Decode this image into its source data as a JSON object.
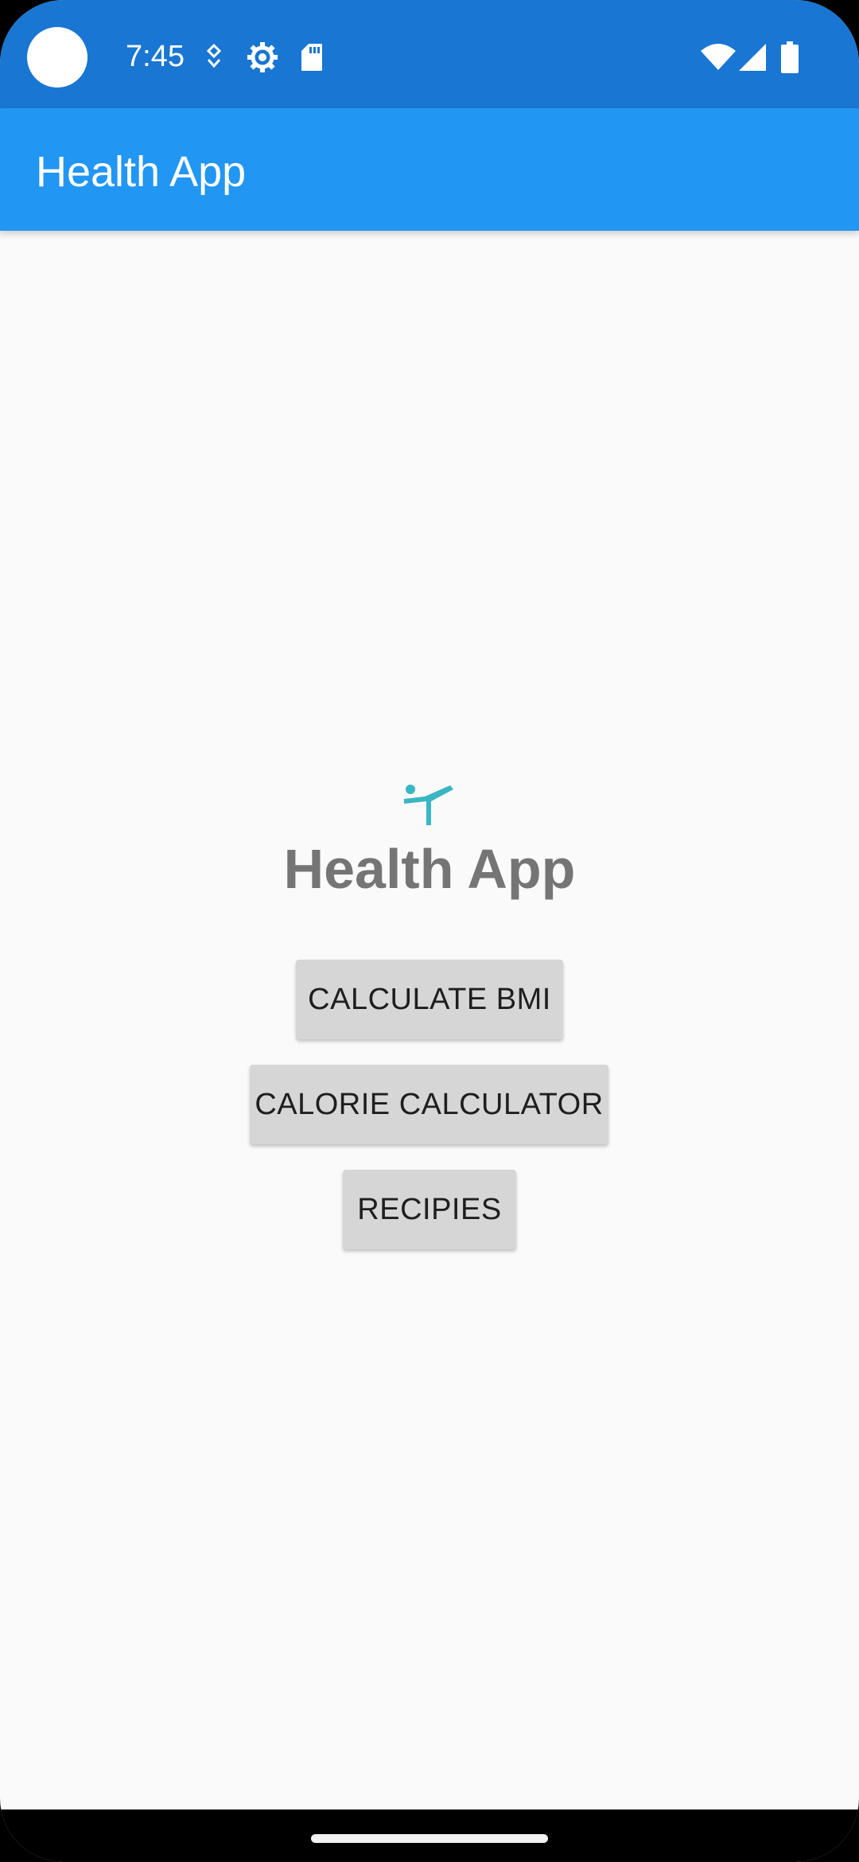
{
  "status_bar": {
    "time": "7:45",
    "left_icons": [
      "notification-icon",
      "settings-gear-icon",
      "sd-card-icon"
    ],
    "right_icons": [
      "wifi-icon",
      "cell-signal-icon",
      "battery-icon"
    ]
  },
  "app_bar": {
    "title": "Health App"
  },
  "main": {
    "logo_icon": "yoga-pose-icon",
    "title": "Health App",
    "buttons": [
      {
        "label": "CALCULATE BMI"
      },
      {
        "label": "CALORIE CALCULATOR"
      },
      {
        "label": "RECIPIES"
      }
    ]
  },
  "colors": {
    "status_bar": "#1976d2",
    "app_bar": "#2196f3",
    "logo": "#3ab5c4",
    "background": "#fafafa",
    "button": "#d6d6d6",
    "title_text": "#757575"
  }
}
